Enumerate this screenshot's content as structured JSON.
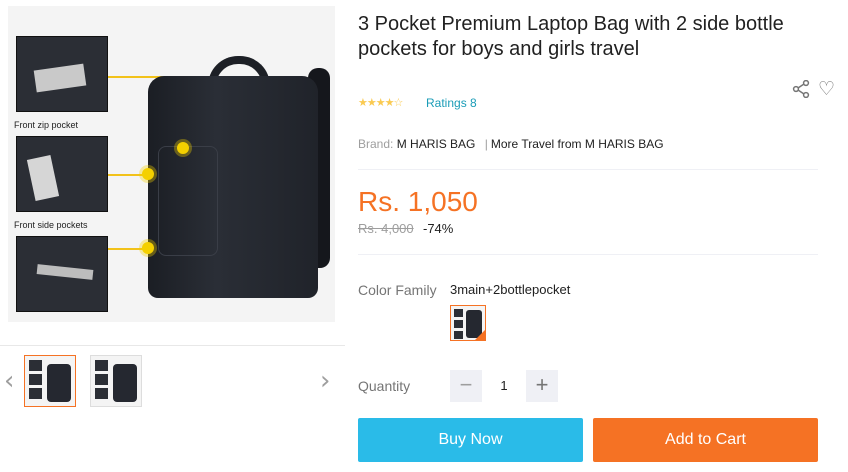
{
  "gallery": {
    "insets": [
      {
        "caption": "Front zip pocket"
      },
      {
        "caption": "Front side pockets"
      },
      {
        "caption": ""
      }
    ],
    "prev_arrow": "‹",
    "next_arrow": "›",
    "thumbnails": [
      {
        "alt": "3 Pocket Premium Laptop Bag thumbnail 1",
        "active": true
      },
      {
        "alt": "3 Pocket Premium Laptop Bag thumbnail 2",
        "active": false
      }
    ]
  },
  "product": {
    "title": "3 Pocket Premium Laptop Bag with 2 side bottle pockets for boys and girls travel",
    "rating_stars": "★★★★☆",
    "ratings_text": "Ratings 8",
    "brand_label": "Brand:",
    "brand_name": "M HARIS BAG",
    "brand_separator": "|",
    "more_from": "More Travel from M HARIS BAG",
    "price": "Rs. 1,050",
    "original_price": "Rs. 4,000",
    "discount": "-74%",
    "color_family_label": "Color Family",
    "color_family_value": "3main+2bottlepocket",
    "quantity_label": "Quantity",
    "quantity_value": "1",
    "qty_minus": "−",
    "qty_plus": "+",
    "buy_now": "Buy Now",
    "add_to_cart": "Add to Cart"
  },
  "icons": {
    "share": "share-icon",
    "wishlist": "heart-icon",
    "share_glyph": "⋖",
    "heart_glyph": "♡"
  },
  "colors": {
    "accent_orange": "#f57224",
    "buy_blue": "#2abbe8",
    "link_blue": "#1a9cb7",
    "star_yellow": "#faca51"
  }
}
